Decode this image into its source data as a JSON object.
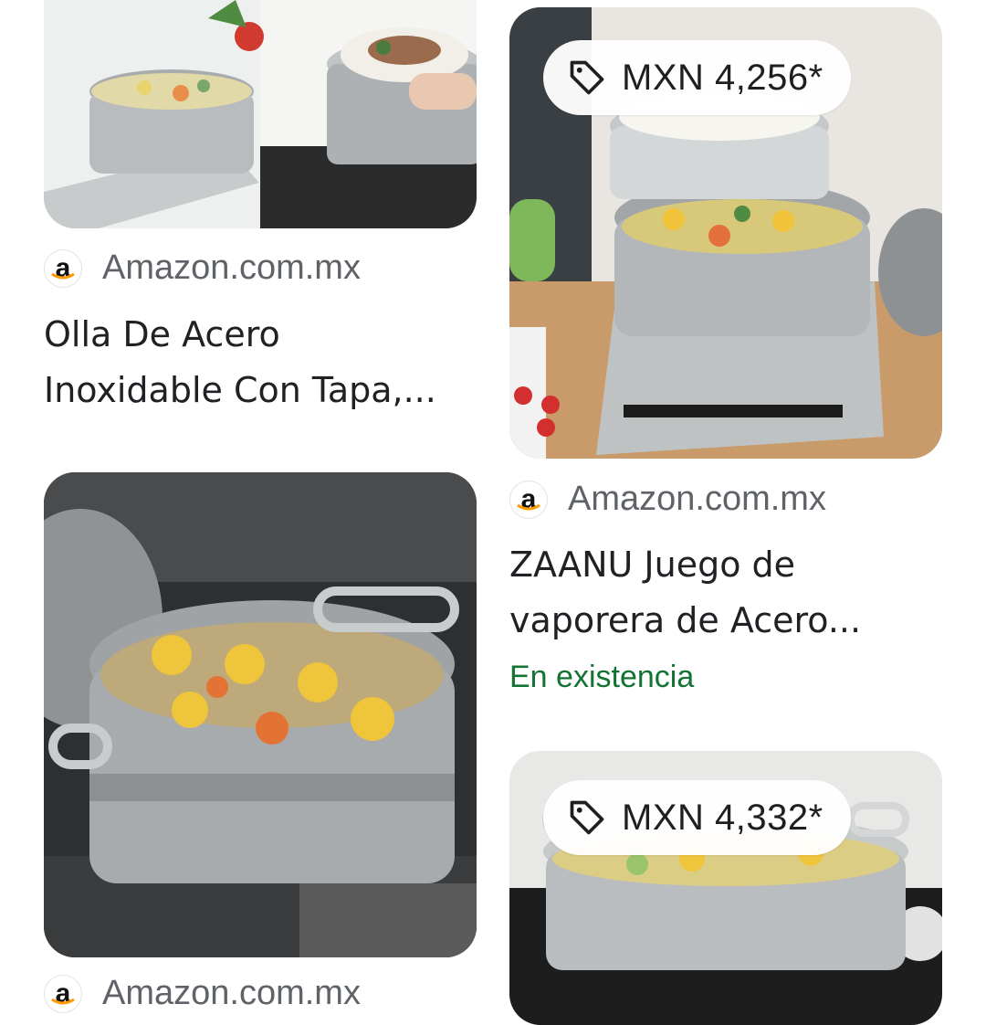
{
  "results": [
    {
      "source": "Amazon.com.mx",
      "title_lines": [
        "Olla De Acero",
        "Inoxidable Con Tapa,..."
      ],
      "image_desc": "steamer-pot-with-vegetables"
    },
    {
      "price": "MXN 4,256*",
      "source": "Amazon.com.mx",
      "title_lines": [
        "ZAANU Juego de",
        "vaporera de Acero..."
      ],
      "availability": "En existencia",
      "image_desc": "two-tier-steamer-on-induction-cooktop"
    },
    {
      "source": "Amazon.com.mx",
      "image_desc": "stock-pot-with-corn-and-carrots"
    },
    {
      "price": "MXN 4,332*",
      "image_desc": "steamer-pot-on-stove"
    }
  ],
  "colors": {
    "source_text": "#5f6368",
    "title_text": "#202124",
    "availability_text": "#137333",
    "amazon_arrow": "#ff9900"
  },
  "icons": {
    "price_tag": "tag-icon",
    "source_logo": "amazon-logo-icon"
  }
}
